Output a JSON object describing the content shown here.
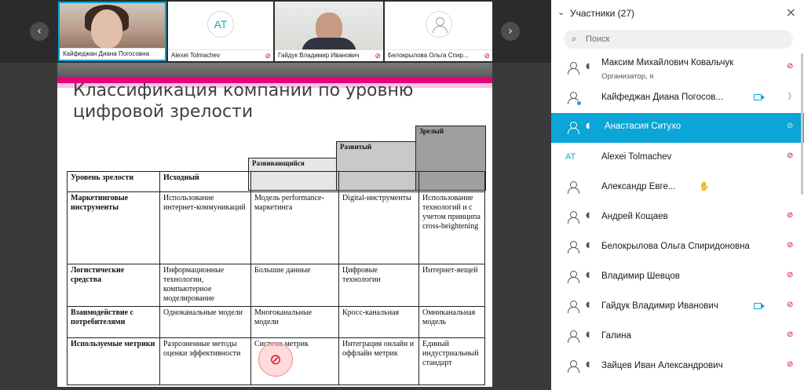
{
  "tiles": [
    {
      "name": "Кайфеджан Диана Погосовна",
      "type": "video",
      "active": true
    },
    {
      "name": "Alexei Tolmachev",
      "initials": "AT",
      "type": "avatar"
    },
    {
      "name": "Гайдук Владимир Иванович",
      "type": "video"
    },
    {
      "name": "Белокрылова Ольга Спир...",
      "type": "avatar"
    }
  ],
  "slide": {
    "title": "Классификация компании по уровню цифровой зрелости",
    "steps": [
      "Развивающийся",
      "Развитый",
      "Зрелый"
    ],
    "table": {
      "header": [
        "Уровень зрелости",
        "Исходный",
        "",
        "",
        ""
      ],
      "rows": [
        [
          "Маркетинговые инструменты",
          "Использование интернет-коммуникаций",
          "Модель performance-маркетинга",
          "Digital-инструменты",
          "Использование технологий и с учетом принципа cross-heightening"
        ],
        [
          "Логистические средства",
          "Информационные технологии, компьютерное моделирование",
          "Большие данные",
          "Цифровые технологии",
          "Интернет-вещей"
        ],
        [
          "Взаимодействие с потребителями",
          "Одноканальные модели",
          "Многоканальные модели",
          "Кросс-канальная",
          "Омниканальная модель"
        ],
        [
          "Используемые метрики",
          "Разрозненные методы оценки эффективности",
          "Система метрик",
          "Интеграция онлайн и оффлайн метрик",
          "Единый индустриальный стандарт"
        ]
      ]
    }
  },
  "panel": {
    "title": "Участники (27)",
    "search_placeholder": "Поиск",
    "participants": [
      {
        "name": "Максим Михайлович Ковальчук",
        "sub": "Организатор, я",
        "mic": "muted"
      },
      {
        "name": "Кайфеджан Диана Погосов...",
        "camera": true,
        "online": true
      },
      {
        "name": "Анастасия Ситухо",
        "selected": true,
        "mic": "muted"
      },
      {
        "name": "Alexei Tolmachev",
        "initials": "AT",
        "mic": "muted"
      },
      {
        "name": "Александр Евге...",
        "hand": true
      },
      {
        "name": "Андрей Кощаев",
        "mic": "muted"
      },
      {
        "name": "Белокрылова Ольга Спиридоновна",
        "mic": "muted"
      },
      {
        "name": "Владимир Шевцов",
        "mic": "muted"
      },
      {
        "name": "Гайдук Владимир Иванович",
        "camera": true,
        "mic": "muted"
      },
      {
        "name": "Галина",
        "mic": "muted"
      },
      {
        "name": "Зайцев Иван Александрович",
        "mic": "muted"
      }
    ]
  },
  "colors": {
    "accent": "#0ba5d8",
    "muted": "#d0021b",
    "slide_pink": "#e6007e"
  }
}
